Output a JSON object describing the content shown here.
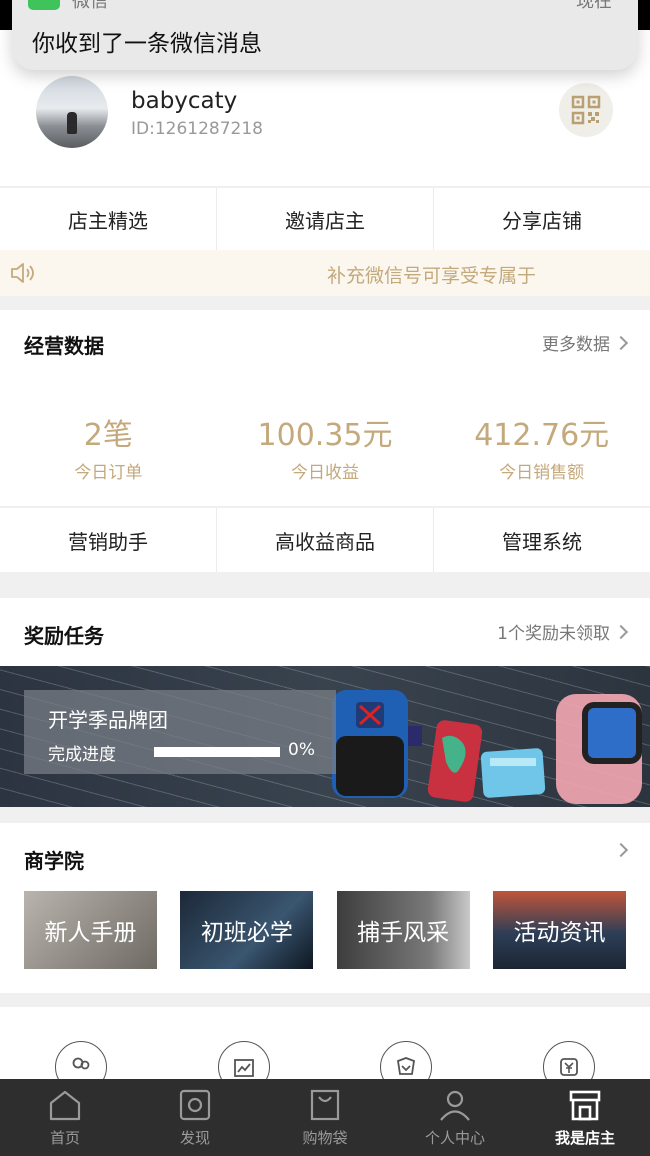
{
  "notification": {
    "app_name": "微信",
    "time": "现在",
    "message": "你收到了一条微信消息"
  },
  "profile": {
    "username": "babycaty",
    "user_id": "ID:1261287218"
  },
  "top_tabs": [
    "店主精选",
    "邀请店主",
    "分享店铺"
  ],
  "notice": {
    "text": "补充微信号可享受专属于"
  },
  "business_data": {
    "title": "经营数据",
    "more": "更多数据",
    "stats": [
      {
        "value": "2笔",
        "label": "今日订单"
      },
      {
        "value": "100.35元",
        "label": "今日收益"
      },
      {
        "value": "412.76元",
        "label": "今日销售额"
      }
    ]
  },
  "tools_row": [
    "营销助手",
    "高收益商品",
    "管理系统"
  ],
  "rewards": {
    "title": "奖励任务",
    "more": "1个奖励未领取",
    "banner": {
      "title": "开学季品牌团",
      "progress_label": "完成进度",
      "progress_value": "0%",
      "progress_fraction": 0
    }
  },
  "academy": {
    "title": "商学院",
    "items": [
      "新人手册",
      "初班必学",
      "捕手风采",
      "活动资讯"
    ]
  },
  "tab_bar": [
    {
      "label": "首页",
      "icon": "home-icon"
    },
    {
      "label": "发现",
      "icon": "discover-icon"
    },
    {
      "label": "购物袋",
      "icon": "bag-icon"
    },
    {
      "label": "个人中心",
      "icon": "person-icon"
    },
    {
      "label": "我是店主",
      "icon": "store-icon",
      "active": true
    }
  ],
  "colors": {
    "accent_gold": "#c4a97c",
    "notice_bg": "#fbf7ef",
    "tabbar_bg": "#2e2e2e"
  }
}
